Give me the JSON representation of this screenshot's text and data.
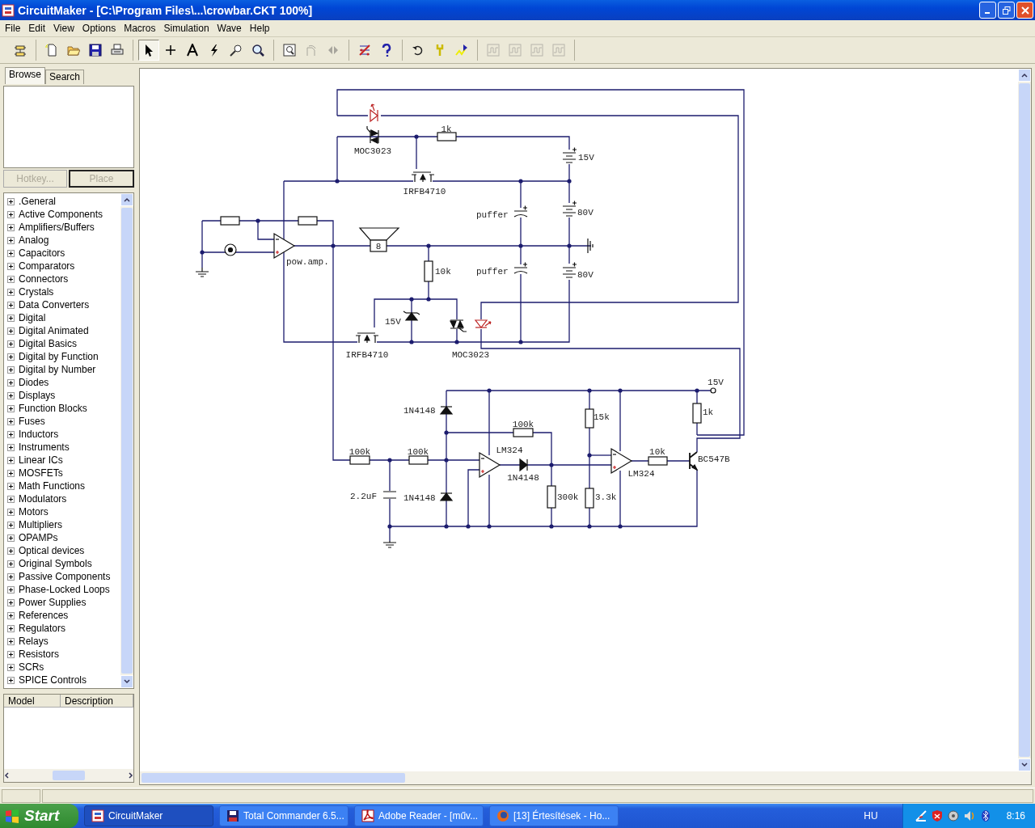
{
  "window": {
    "title": "CircuitMaker - [C:\\Program Files\\...\\crowbar.CKT 100%]"
  },
  "menu": [
    "File",
    "Edit",
    "View",
    "Options",
    "Macros",
    "Simulation",
    "Wave",
    "Help"
  ],
  "toolbar": [
    [
      {
        "kind": "panel",
        "selected": false,
        "disabled": false
      }
    ],
    [
      {
        "kind": "new",
        "selected": false,
        "disabled": false
      },
      {
        "kind": "open",
        "selected": false,
        "disabled": false
      },
      {
        "kind": "save",
        "selected": false,
        "disabled": false
      },
      {
        "kind": "print",
        "selected": false,
        "disabled": false
      }
    ],
    [
      {
        "kind": "arrow",
        "selected": true,
        "disabled": false
      },
      {
        "kind": "wire",
        "selected": false,
        "disabled": false
      },
      {
        "kind": "text",
        "selected": false,
        "disabled": false
      },
      {
        "kind": "bolt",
        "selected": false,
        "disabled": false
      },
      {
        "kind": "probe",
        "selected": false,
        "disabled": false
      },
      {
        "kind": "zoom",
        "selected": false,
        "disabled": false
      }
    ],
    [
      {
        "kind": "fit",
        "selected": false,
        "disabled": false
      },
      {
        "kind": "rotate",
        "selected": false,
        "disabled": true
      },
      {
        "kind": "mirror",
        "selected": false,
        "disabled": true
      }
    ],
    [
      {
        "kind": "netlist",
        "selected": false,
        "disabled": false
      },
      {
        "kind": "help",
        "selected": false,
        "disabled": false
      }
    ],
    [
      {
        "kind": "reset",
        "selected": false,
        "disabled": false
      },
      {
        "kind": "tools",
        "selected": false,
        "disabled": false
      },
      {
        "kind": "run",
        "selected": false,
        "disabled": false
      }
    ],
    [
      {
        "kind": "wave",
        "selected": false,
        "disabled": true
      },
      {
        "kind": "wave",
        "selected": false,
        "disabled": true
      },
      {
        "kind": "wave",
        "selected": false,
        "disabled": true
      },
      {
        "kind": "wave",
        "selected": false,
        "disabled": true
      }
    ]
  ],
  "sidebar": {
    "tabs": [
      {
        "label": "Browse",
        "selected": true
      },
      {
        "label": "Search",
        "selected": false
      }
    ],
    "buttons": [
      {
        "label": "Hotkey...",
        "disabled": true
      },
      {
        "label": "Place",
        "disabled": true
      }
    ],
    "tree": [
      {
        "label": ".General",
        "expanded": false
      },
      {
        "label": "Active Components",
        "expanded": false
      },
      {
        "label": "Amplifiers/Buffers",
        "expanded": false
      },
      {
        "label": "Analog",
        "expanded": false
      },
      {
        "label": "Capacitors",
        "expanded": false
      },
      {
        "label": "Comparators",
        "expanded": false
      },
      {
        "label": "Connectors",
        "expanded": false
      },
      {
        "label": "Crystals",
        "expanded": false
      },
      {
        "label": "Data Converters",
        "expanded": false
      },
      {
        "label": "Digital",
        "expanded": false
      },
      {
        "label": "Digital Animated",
        "expanded": false
      },
      {
        "label": "Digital Basics",
        "expanded": false
      },
      {
        "label": "Digital by Function",
        "expanded": false
      },
      {
        "label": "Digital by Number",
        "expanded": false
      },
      {
        "label": "Diodes",
        "expanded": false
      },
      {
        "label": "Displays",
        "expanded": false
      },
      {
        "label": "Function Blocks",
        "expanded": false
      },
      {
        "label": "Fuses",
        "expanded": false
      },
      {
        "label": "Inductors",
        "expanded": false
      },
      {
        "label": "Instruments",
        "expanded": false
      },
      {
        "label": "Linear ICs",
        "expanded": false
      },
      {
        "label": "MOSFETs",
        "expanded": false
      },
      {
        "label": "Math Functions",
        "expanded": false
      },
      {
        "label": "Modulators",
        "expanded": false
      },
      {
        "label": "Motors",
        "expanded": false
      },
      {
        "label": "Multipliers",
        "expanded": false
      },
      {
        "label": "OPAMPs",
        "expanded": false
      },
      {
        "label": "Optical devices",
        "expanded": false
      },
      {
        "label": "Original Symbols",
        "expanded": false
      },
      {
        "label": "Passive Components",
        "expanded": false
      },
      {
        "label": "Phase-Locked Loops",
        "expanded": false
      },
      {
        "label": "Power Supplies",
        "expanded": false
      },
      {
        "label": "References",
        "expanded": false
      },
      {
        "label": "Regulators",
        "expanded": false
      },
      {
        "label": "Relays",
        "expanded": false
      },
      {
        "label": "Resistors",
        "expanded": false
      },
      {
        "label": "SCRs",
        "expanded": false
      },
      {
        "label": "SPICE Controls",
        "expanded": false
      }
    ],
    "columns": [
      "Model",
      "Description"
    ]
  },
  "schematic": {
    "labels": [
      "1k",
      "MOC3023",
      "15V",
      "IRFB4710",
      "puffer",
      "80V",
      "pow.amp.",
      "8",
      "10k",
      "puffer",
      "80V",
      "15V",
      "IRFB4710",
      "MOC3023",
      "15V",
      "1N4148",
      "100k",
      "15k",
      "1k",
      "100k",
      "100k",
      "LM324",
      "10k",
      "BC547B",
      "1N4148",
      "LM324",
      "2.2uF",
      "1N4148",
      "300k",
      "3.3k"
    ]
  },
  "taskbar": {
    "start": "Start",
    "tasks": [
      {
        "label": "CircuitMaker",
        "kind": "app",
        "selected": true
      },
      {
        "label": "Total Commander 6.5...",
        "kind": "disk",
        "selected": false
      },
      {
        "label": "Adobe Reader - [műv...",
        "kind": "pdf",
        "selected": false
      },
      {
        "label": "[13] Értesítések - Ho...",
        "kind": "browser",
        "selected": false
      }
    ],
    "language": "HU",
    "clock": "8:16"
  }
}
